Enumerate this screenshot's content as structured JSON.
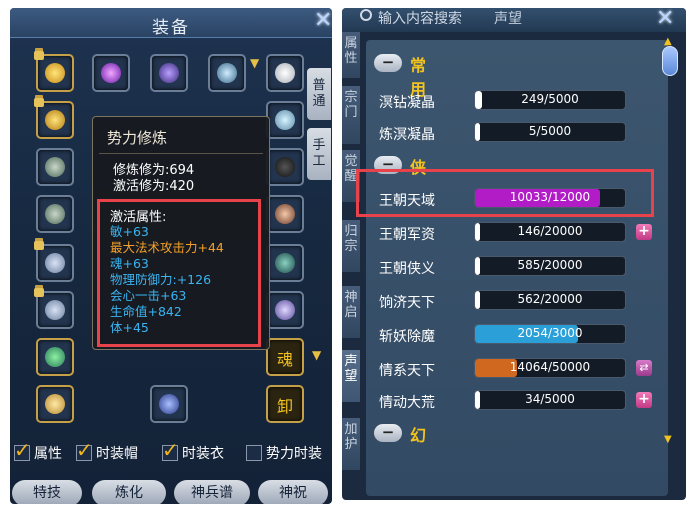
{
  "left": {
    "title": "装备",
    "side_tabs": [
      "普通",
      "手工"
    ],
    "tooltip": {
      "title": "势力修炼",
      "stats": [
        "修炼修为:694",
        "激活修为:420"
      ],
      "attr_header": "激活属性:",
      "attrs": [
        {
          "text": "敏+63",
          "color": "#3ab4f2"
        },
        {
          "text": "最大法术攻击力+44",
          "color": "#f2a02a"
        },
        {
          "text": "魂+63",
          "color": "#3ab4f2"
        },
        {
          "text": "物理防御力:+126",
          "color": "#3ab4f2"
        },
        {
          "text": "会心一击+63",
          "color": "#3ab4f2"
        },
        {
          "text": "生命值+842",
          "color": "#3ab4f2"
        },
        {
          "text": "体+45",
          "color": "#3ab4f2"
        }
      ]
    },
    "slot_labels": {
      "soul": "魂",
      "unload": "卸"
    },
    "checkboxes": [
      {
        "label": "属性",
        "checked": true
      },
      {
        "label": "时装帽",
        "checked": true
      },
      {
        "label": "时装衣",
        "checked": true
      },
      {
        "label": "势力时装",
        "checked": false
      }
    ],
    "bottom_tabs": [
      "特技",
      "炼化",
      "神兵谱",
      "神祝"
    ]
  },
  "right": {
    "search_placeholder": "输入内容搜索",
    "header": "声望",
    "vertical_tabs": [
      "属性",
      "宗门",
      "觉醒",
      "归宗",
      "神启",
      "声望",
      "加护"
    ],
    "sections": [
      {
        "name": "常用",
        "rows": [
          {
            "label": "溟钻凝晶",
            "value": "249/5000",
            "progress": 0.0498,
            "color": "#ffffff",
            "action": ""
          },
          {
            "label": "炼溟凝晶",
            "value": "5/5000",
            "progress": 0.001,
            "color": "#ffffff",
            "action": ""
          }
        ]
      },
      {
        "name": "侠",
        "rows": [
          {
            "label": "王朝天域",
            "value": "10033/12000",
            "progress": 0.836,
            "color": "#b21cc6",
            "action": ""
          },
          {
            "label": "王朝军资",
            "value": "146/20000",
            "progress": 0.0073,
            "color": "#ffffff",
            "action": "plus"
          },
          {
            "label": "王朝侠义",
            "value": "585/20000",
            "progress": 0.029,
            "color": "#ffffff",
            "action": ""
          },
          {
            "label": "饷济天下",
            "value": "562/20000",
            "progress": 0.028,
            "color": "#ffffff",
            "action": ""
          },
          {
            "label": "斩妖除魔",
            "value": "2054/3000",
            "progress": 0.685,
            "color": "#2a9fd8",
            "action": ""
          },
          {
            "label": "情系天下",
            "value": "14064/50000",
            "progress": 0.281,
            "color": "#d06820",
            "action": "swap"
          },
          {
            "label": "情动大荒",
            "value": "34/5000",
            "progress": 0.0068,
            "color": "#ffffff",
            "action": "plus"
          }
        ]
      },
      {
        "name": "幻",
        "rows": []
      }
    ]
  }
}
